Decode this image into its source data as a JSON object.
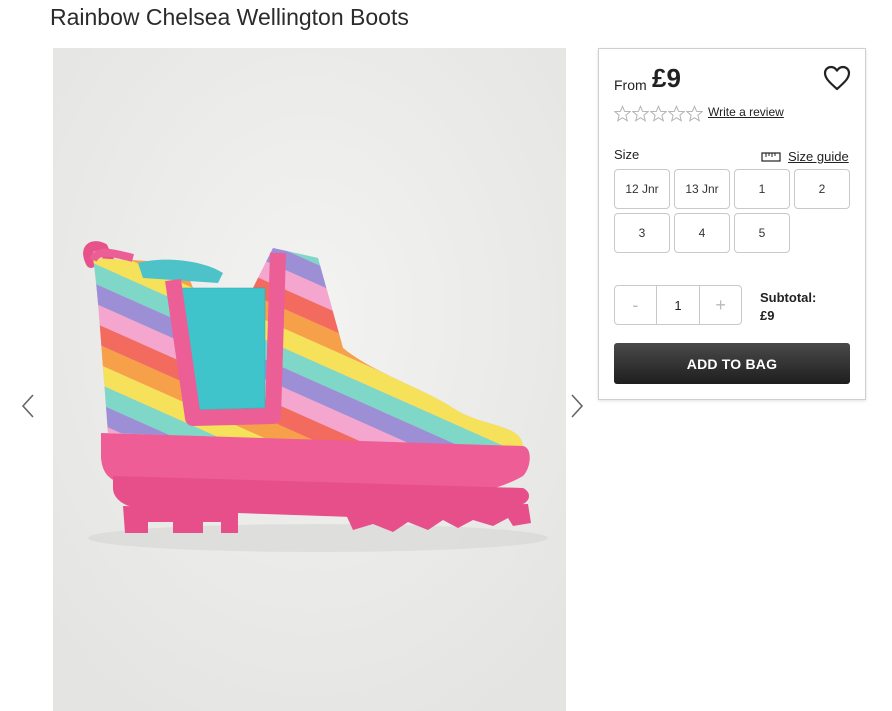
{
  "product": {
    "title": "Rainbow Chelsea Wellington Boots",
    "image_alt": "Rainbow Chelsea Wellington Boots"
  },
  "gallery": {
    "prev_icon": "chevron-left-icon",
    "next_icon": "chevron-right-icon"
  },
  "purchase_panel": {
    "from_label": "From",
    "price": "£9",
    "wishlist_icon": "heart-icon",
    "rating": {
      "stars_filled": 0,
      "stars_total": 5,
      "review_link": "Write a review"
    },
    "size_label": "Size",
    "size_guide_icon": "ruler-icon",
    "size_guide_label": "Size guide",
    "sizes": [
      "12 Jnr",
      "13 Jnr",
      "1",
      "2",
      "3",
      "4",
      "5"
    ],
    "quantity": {
      "decrement": "-",
      "value": "1",
      "increment": "+"
    },
    "subtotal_label": "Subtotal:",
    "subtotal_value": "£9",
    "add_to_bag": "ADD TO BAG",
    "accent_color": "#262626"
  }
}
